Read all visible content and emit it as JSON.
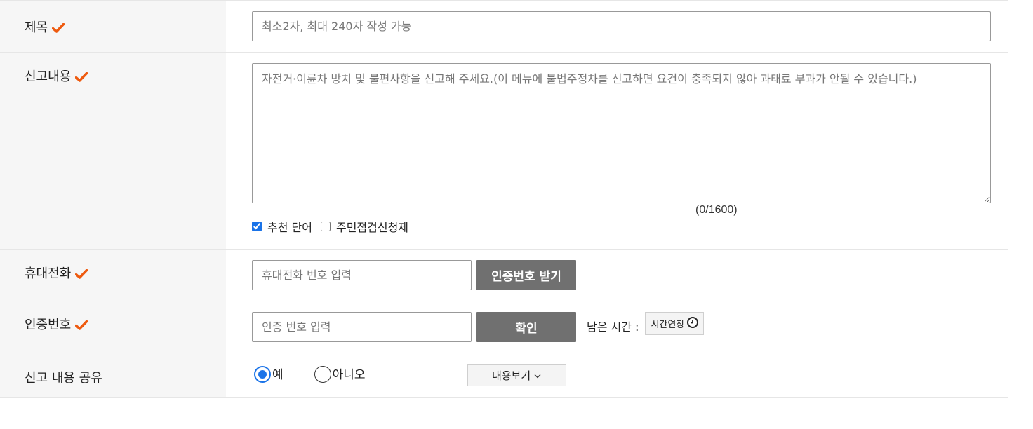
{
  "form": {
    "title": {
      "label": "제목",
      "placeholder": "최소2자, 최대 240자 작성 가능"
    },
    "content": {
      "label": "신고내용",
      "placeholder": "자전거·이륜차 방치 및 불편사항을 신고해 주세요.(이 메뉴에 불법주정차를 신고하면 요건이 충족되지 않아 과태료 부과가 안될 수 있습니다.)",
      "counter": "(0/1600)",
      "option_recommend": "추천 단어",
      "option_recommend_checked": true,
      "option_resident": "주민점검신청제",
      "option_resident_checked": false
    },
    "phone": {
      "label": "휴대전화",
      "placeholder": "휴대전화 번호 입력",
      "button": "인증번호 받기"
    },
    "auth": {
      "label": "인증번호",
      "placeholder": "인증 번호 입력",
      "button": "확인",
      "remaining_label": "남은 시간 :",
      "extend_button": "시간연장"
    },
    "share": {
      "label": "신고 내용 공유",
      "yes": "예",
      "no": "아니오",
      "selected": "yes",
      "view_button": "내용보기"
    }
  },
  "colors": {
    "required_mark": "#ee5a0f",
    "button_dark": "#707070",
    "radio_accent": "#1a73e8"
  },
  "icons": {
    "required": "check-mark-icon",
    "clock": "clock-icon",
    "chevron": "chevron-down-icon"
  }
}
